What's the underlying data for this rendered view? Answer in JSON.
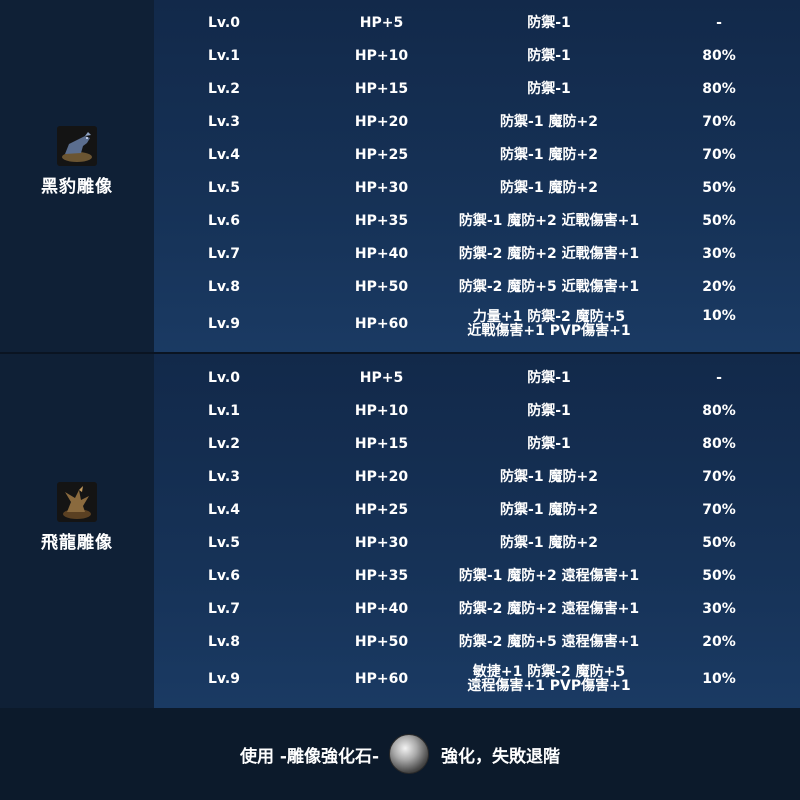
{
  "statues": [
    {
      "name": "黑豹雕像",
      "icon": "black-panther-statue-icon",
      "levels": [
        {
          "lv": "Lv.0",
          "hp": "HP+5",
          "effect": [
            "防禦-1"
          ],
          "rate": "-"
        },
        {
          "lv": "Lv.1",
          "hp": "HP+10",
          "effect": [
            "防禦-1"
          ],
          "rate": "80%"
        },
        {
          "lv": "Lv.2",
          "hp": "HP+15",
          "effect": [
            "防禦-1"
          ],
          "rate": "80%"
        },
        {
          "lv": "Lv.3",
          "hp": "HP+20",
          "effect": [
            "防禦-1 魔防+2"
          ],
          "rate": "70%"
        },
        {
          "lv": "Lv.4",
          "hp": "HP+25",
          "effect": [
            "防禦-1 魔防+2"
          ],
          "rate": "70%"
        },
        {
          "lv": "Lv.5",
          "hp": "HP+30",
          "effect": [
            "防禦-1 魔防+2"
          ],
          "rate": "50%"
        },
        {
          "lv": "Lv.6",
          "hp": "HP+35",
          "effect": [
            "防禦-1 魔防+2 近戰傷害+1"
          ],
          "rate": "50%"
        },
        {
          "lv": "Lv.7",
          "hp": "HP+40",
          "effect": [
            "防禦-2 魔防+2 近戰傷害+1"
          ],
          "rate": "30%"
        },
        {
          "lv": "Lv.8",
          "hp": "HP+50",
          "effect": [
            "防禦-2 魔防+5 近戰傷害+1"
          ],
          "rate": "20%"
        },
        {
          "lv": "Lv.9",
          "hp": "HP+60",
          "effect": [
            "力量+1 防禦-2 魔防+5",
            "近戰傷害+1 PVP傷害+1"
          ],
          "rate": "10%"
        }
      ]
    },
    {
      "name": "飛龍雕像",
      "icon": "wyvern-statue-icon",
      "levels": [
        {
          "lv": "Lv.0",
          "hp": "HP+5",
          "effect": [
            "防禦-1"
          ],
          "rate": "-"
        },
        {
          "lv": "Lv.1",
          "hp": "HP+10",
          "effect": [
            "防禦-1"
          ],
          "rate": "80%"
        },
        {
          "lv": "Lv.2",
          "hp": "HP+15",
          "effect": [
            "防禦-1"
          ],
          "rate": "80%"
        },
        {
          "lv": "Lv.3",
          "hp": "HP+20",
          "effect": [
            "防禦-1 魔防+2"
          ],
          "rate": "70%"
        },
        {
          "lv": "Lv.4",
          "hp": "HP+25",
          "effect": [
            "防禦-1 魔防+2"
          ],
          "rate": "70%"
        },
        {
          "lv": "Lv.5",
          "hp": "HP+30",
          "effect": [
            "防禦-1 魔防+2"
          ],
          "rate": "50%"
        },
        {
          "lv": "Lv.6",
          "hp": "HP+35",
          "effect": [
            "防禦-1 魔防+2 遠程傷害+1"
          ],
          "rate": "50%"
        },
        {
          "lv": "Lv.7",
          "hp": "HP+40",
          "effect": [
            "防禦-2 魔防+2 遠程傷害+1"
          ],
          "rate": "30%"
        },
        {
          "lv": "Lv.8",
          "hp": "HP+50",
          "effect": [
            "防禦-2 魔防+5 遠程傷害+1"
          ],
          "rate": "20%"
        },
        {
          "lv": "Lv.9",
          "hp": "HP+60",
          "effect": [
            "敏捷+1 防禦-2 魔防+5",
            "遠程傷害+1 PVP傷害+1"
          ],
          "rate": "10%"
        }
      ]
    }
  ],
  "footer": {
    "prefix": "使用 -雕像強化石-",
    "stone_icon": "enhancement-stone-icon",
    "suffix": "強化，失敗退階"
  }
}
